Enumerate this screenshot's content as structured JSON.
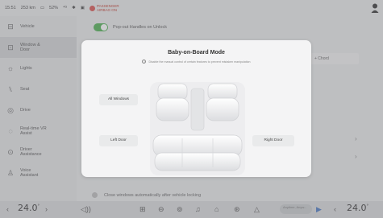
{
  "status": {
    "time": "15:51",
    "range": "253 km",
    "battery": "52%",
    "passenger_airbag": "PASSENGER\nAIRBAG ON"
  },
  "sidebar": {
    "items": [
      {
        "label": "Vehicle",
        "icon": "car-icon"
      },
      {
        "label": "Window & Door",
        "icon": "window-door-icon",
        "active": true
      },
      {
        "label": "Lights",
        "icon": "lights-icon"
      },
      {
        "label": "Seat",
        "icon": "seat-icon"
      },
      {
        "label": "Drive",
        "icon": "drive-icon"
      },
      {
        "label": "Real-time VR Assist",
        "icon": "vr-assist-icon"
      },
      {
        "label": "Driver Assistance",
        "icon": "driver-assist-icon"
      },
      {
        "label": "Voice Assistant",
        "icon": "voice-icon"
      }
    ]
  },
  "content": {
    "toggle_label": "Pop-out Handles on Unlock",
    "field_label": "+ Chord",
    "bottom_label": "Close windows automatically after vehicle locking"
  },
  "modal": {
    "title": "Baby-on-Board Mode",
    "subtitle": "Disable the manual control of certain features to prevent mistaken manipulation",
    "buttons": {
      "all_windows": "All Windows",
      "left_door": "Left Door",
      "right_door": "Right Door"
    }
  },
  "dock": {
    "temp_left": "24.0",
    "temp_right": "24.0",
    "temp_unit": "°",
    "media_title": "Anytime, Anyw..."
  },
  "colors": {
    "toggle_on": "#4caf50",
    "passenger_airbag": "#d9534f"
  }
}
